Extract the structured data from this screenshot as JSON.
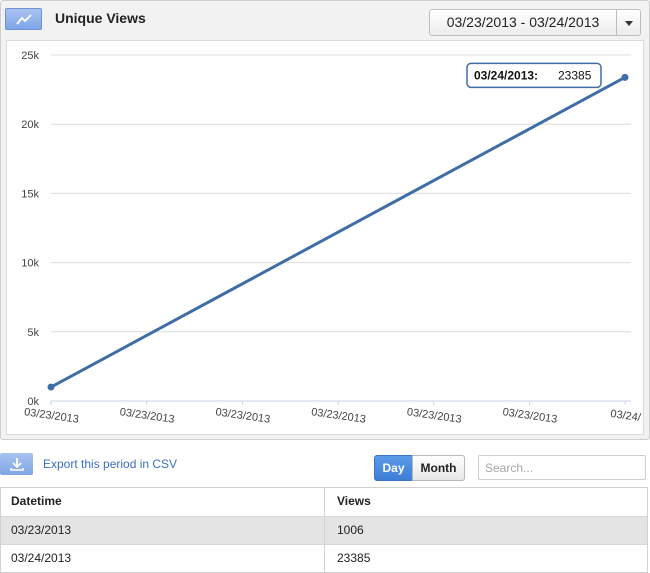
{
  "header": {
    "icon": "line-chart-icon",
    "title": "Unique Views",
    "date_range": "03/23/2013 - 03/24/2013"
  },
  "tooltip": {
    "label": "03/24/2013:",
    "value": "23385"
  },
  "chart_data": {
    "type": "line",
    "title": "",
    "xlabel": "",
    "ylabel": "",
    "ylim": [
      0,
      25000
    ],
    "y_ticks": [
      "0k",
      "5k",
      "10k",
      "15k",
      "20k",
      "25k"
    ],
    "x_tick_labels": [
      "03/23/2013",
      "03/23/2013",
      "03/23/2013",
      "03/23/2013",
      "03/23/2013",
      "03/23/2013",
      "03/24/"
    ],
    "grid": true,
    "series": [
      {
        "x": [
          "03/23/2013",
          "03/24/2013"
        ],
        "values": [
          1006,
          23385
        ],
        "color": "#3f6ea6"
      }
    ]
  },
  "toolbar": {
    "export_icon": "download-icon",
    "export_label": "Export this period in CSV",
    "day_label": "Day",
    "month_label": "Month",
    "search_placeholder": "Search..."
  },
  "table": {
    "columns": [
      "Datetime",
      "Views"
    ],
    "rows": [
      [
        "03/23/2013",
        "1006"
      ],
      [
        "03/24/2013",
        "23385"
      ]
    ]
  },
  "colors": {
    "accent": "#3e7ed6",
    "line": "#3f6ea6",
    "link": "#3a6fc4"
  }
}
